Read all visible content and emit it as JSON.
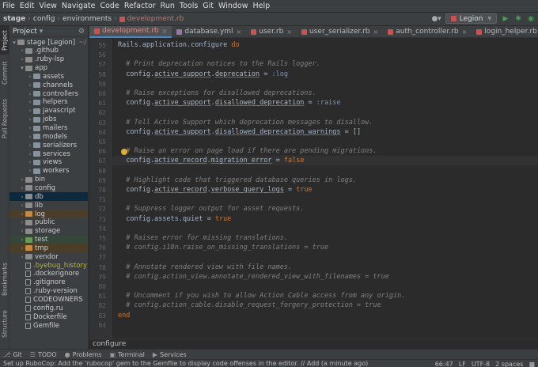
{
  "menu": [
    "File",
    "Edit",
    "View",
    "Navigate",
    "Code",
    "Refactor",
    "Run",
    "Tools",
    "Git",
    "Window",
    "Help"
  ],
  "breadcrumbs": [
    "stage",
    "config",
    "environments",
    "development.rb"
  ],
  "run_config": "Legion",
  "project": {
    "panel_title": "Project",
    "root": "stage [Legion]",
    "root_path": "~/",
    "items": [
      {
        "label": ".github",
        "depth": 1,
        "type": "folder",
        "state": "collapsed"
      },
      {
        "label": ".ruby-lsp",
        "depth": 1,
        "type": "folder",
        "state": "collapsed"
      },
      {
        "label": "app",
        "depth": 1,
        "type": "folder",
        "state": "expanded"
      },
      {
        "label": "assets",
        "depth": 2,
        "type": "folder",
        "state": "collapsed"
      },
      {
        "label": "channels",
        "depth": 2,
        "type": "folder",
        "state": "collapsed"
      },
      {
        "label": "controllers",
        "depth": 2,
        "type": "folder",
        "state": "collapsed"
      },
      {
        "label": "helpers",
        "depth": 2,
        "type": "folder",
        "state": "collapsed"
      },
      {
        "label": "javascript",
        "depth": 2,
        "type": "folder",
        "state": "collapsed"
      },
      {
        "label": "jobs",
        "depth": 2,
        "type": "folder",
        "state": "collapsed"
      },
      {
        "label": "mailers",
        "depth": 2,
        "type": "folder",
        "state": "collapsed"
      },
      {
        "label": "models",
        "depth": 2,
        "type": "folder",
        "state": "collapsed"
      },
      {
        "label": "serializers",
        "depth": 2,
        "type": "folder",
        "state": "collapsed"
      },
      {
        "label": "services",
        "depth": 2,
        "type": "folder",
        "state": "collapsed"
      },
      {
        "label": "views",
        "depth": 2,
        "type": "folder",
        "state": "collapsed"
      },
      {
        "label": "workers",
        "depth": 2,
        "type": "folder",
        "state": "collapsed"
      },
      {
        "label": "bin",
        "depth": 1,
        "type": "folder",
        "state": "collapsed"
      },
      {
        "label": "config",
        "depth": 1,
        "type": "folder",
        "state": "collapsed"
      },
      {
        "label": "db",
        "depth": 1,
        "type": "folder",
        "state": "collapsed",
        "highlight": "db"
      },
      {
        "label": "lib",
        "depth": 1,
        "type": "folder",
        "state": "collapsed"
      },
      {
        "label": "log",
        "depth": 1,
        "type": "folder",
        "state": "collapsed",
        "highlight": "log"
      },
      {
        "label": "public",
        "depth": 1,
        "type": "folder",
        "state": "collapsed"
      },
      {
        "label": "storage",
        "depth": 1,
        "type": "folder",
        "state": "collapsed"
      },
      {
        "label": "test",
        "depth": 1,
        "type": "folder",
        "state": "collapsed",
        "highlight": "test"
      },
      {
        "label": "tmp",
        "depth": 1,
        "type": "folder",
        "state": "collapsed",
        "highlight": "tmp"
      },
      {
        "label": "vendor",
        "depth": 1,
        "type": "folder",
        "state": "collapsed"
      },
      {
        "label": ".byebug_history",
        "depth": 1,
        "type": "file",
        "color": "#bbb529"
      },
      {
        "label": ".dockerignore",
        "depth": 1,
        "type": "file"
      },
      {
        "label": ".gitignore",
        "depth": 1,
        "type": "file"
      },
      {
        "label": ".ruby-version",
        "depth": 1,
        "type": "file"
      },
      {
        "label": "CODEOWNERS",
        "depth": 1,
        "type": "file"
      },
      {
        "label": "config.ru",
        "depth": 1,
        "type": "file"
      },
      {
        "label": "Dockerfile",
        "depth": 1,
        "type": "file"
      },
      {
        "label": "Gemfile",
        "depth": 1,
        "type": "file"
      }
    ]
  },
  "left_tabs": [
    "Project",
    "Commit",
    "Pull Requests",
    "Bookmarks",
    "Structure"
  ],
  "tabs": [
    {
      "label": "development.rb",
      "active": true
    },
    {
      "label": "database.yml",
      "active": false
    },
    {
      "label": "user.rb",
      "active": false
    },
    {
      "label": "user_serializer.rb",
      "active": false
    },
    {
      "label": "auth_controller.rb",
      "active": false
    },
    {
      "label": "login_helper.rb",
      "active": false
    }
  ],
  "editor": {
    "current_line": 66,
    "lines": [
      {
        "n": 55,
        "parts": [
          [
            "Rails",
            "const"
          ],
          [
            ".",
            ""
          ],
          [
            "application",
            ""
          ],
          [
            ".",
            ""
          ],
          [
            "configure",
            ""
          ],
          [
            " ",
            ""
          ],
          [
            "do",
            "kw"
          ]
        ]
      },
      {
        "n": 56,
        "parts": []
      },
      {
        "n": 57,
        "parts": [
          [
            "  # Print deprecation notices to the Rails logger.",
            "comment"
          ]
        ]
      },
      {
        "n": 58,
        "parts": [
          [
            "  config.",
            ""
          ],
          [
            "active_support",
            "ul"
          ],
          [
            ".",
            ""
          ],
          [
            "deprecation",
            "ul"
          ],
          [
            " = ",
            ""
          ],
          [
            ":log",
            "sym"
          ]
        ]
      },
      {
        "n": 59,
        "parts": []
      },
      {
        "n": 60,
        "parts": [
          [
            "  # Raise exceptions for disallowed deprecations.",
            "comment"
          ]
        ]
      },
      {
        "n": 61,
        "parts": [
          [
            "  config.",
            ""
          ],
          [
            "active_support",
            "ul"
          ],
          [
            ".",
            ""
          ],
          [
            "disallowed_deprecation",
            "ul"
          ],
          [
            " = ",
            ""
          ],
          [
            ":raise",
            "sym"
          ]
        ]
      },
      {
        "n": 62,
        "parts": []
      },
      {
        "n": 63,
        "parts": [
          [
            "  # Tell Active Support which deprecation messages to disallow.",
            "comment"
          ]
        ]
      },
      {
        "n": 64,
        "parts": [
          [
            "  config.",
            ""
          ],
          [
            "active_support",
            "ul"
          ],
          [
            ".",
            ""
          ],
          [
            "disallowed_deprecation_warnings",
            "ul"
          ],
          [
            " = []",
            ""
          ]
        ]
      },
      {
        "n": 65,
        "parts": []
      },
      {
        "n": 66,
        "parts": [
          [
            "  # Raise an error on page load if there are pending migrations.",
            "comment"
          ]
        ]
      },
      {
        "n": 67,
        "parts": [
          [
            "  config.",
            ""
          ],
          [
            "active_record",
            "ul"
          ],
          [
            ".",
            ""
          ],
          [
            "migration_error",
            "ul"
          ],
          [
            " = ",
            ""
          ],
          [
            "false",
            "kw"
          ]
        ]
      },
      {
        "n": 68,
        "parts": []
      },
      {
        "n": 69,
        "parts": [
          [
            "  # Highlight code that triggered database queries in logs.",
            "comment"
          ]
        ]
      },
      {
        "n": 70,
        "parts": [
          [
            "  config.",
            ""
          ],
          [
            "active_record",
            "ul"
          ],
          [
            ".",
            ""
          ],
          [
            "verbose_query_logs",
            "ul"
          ],
          [
            " = ",
            ""
          ],
          [
            "true",
            "kw"
          ]
        ]
      },
      {
        "n": 71,
        "parts": []
      },
      {
        "n": 72,
        "parts": [
          [
            "  # Suppress logger output for asset requests.",
            "comment"
          ]
        ]
      },
      {
        "n": 73,
        "parts": [
          [
            "  config.assets.quiet = ",
            ""
          ],
          [
            "true",
            "kw"
          ]
        ]
      },
      {
        "n": 74,
        "parts": []
      },
      {
        "n": 75,
        "parts": [
          [
            "  # Raises error for missing translations.",
            "comment"
          ]
        ]
      },
      {
        "n": 76,
        "parts": [
          [
            "  # config.i18n.raise_on_missing_translations = true",
            "comment"
          ]
        ]
      },
      {
        "n": 77,
        "parts": []
      },
      {
        "n": 78,
        "parts": [
          [
            "  # Annotate rendered view with file names.",
            "comment"
          ]
        ]
      },
      {
        "n": 79,
        "parts": [
          [
            "  # config.action_view.annotate_rendered_view_with_filenames = true",
            "comment"
          ]
        ]
      },
      {
        "n": 80,
        "parts": []
      },
      {
        "n": 81,
        "parts": [
          [
            "  # Uncomment if you wish to allow Action Cable access from any origin.",
            "comment"
          ]
        ]
      },
      {
        "n": 82,
        "parts": [
          [
            "  # config.action_cable.disable_request_forgery_protection = true",
            "comment"
          ]
        ]
      },
      {
        "n": 83,
        "parts": [
          [
            "end",
            "kw"
          ]
        ]
      },
      {
        "n": 84,
        "parts": []
      }
    ]
  },
  "editor_breadcrumb": "configure",
  "bottom_tools": [
    {
      "label": "Git",
      "icon": "git-icon"
    },
    {
      "label": "TODO",
      "icon": "todo-icon"
    },
    {
      "label": "Problems",
      "icon": "problems-icon"
    },
    {
      "label": "Terminal",
      "icon": "terminal-icon"
    },
    {
      "label": "Services",
      "icon": "services-icon"
    }
  ],
  "status": {
    "message": "Set up RuboCop: Add the 'rubocop' gem to the Gemfile to display code offenses in the editor. // Add (a minute ago)",
    "position": "66:47",
    "line_sep": "LF",
    "encoding": "UTF-8",
    "indent": "2 spaces"
  },
  "colors": {
    "accent": "#4a88c7",
    "run": "#499c54",
    "file_tab": "#c75450"
  }
}
